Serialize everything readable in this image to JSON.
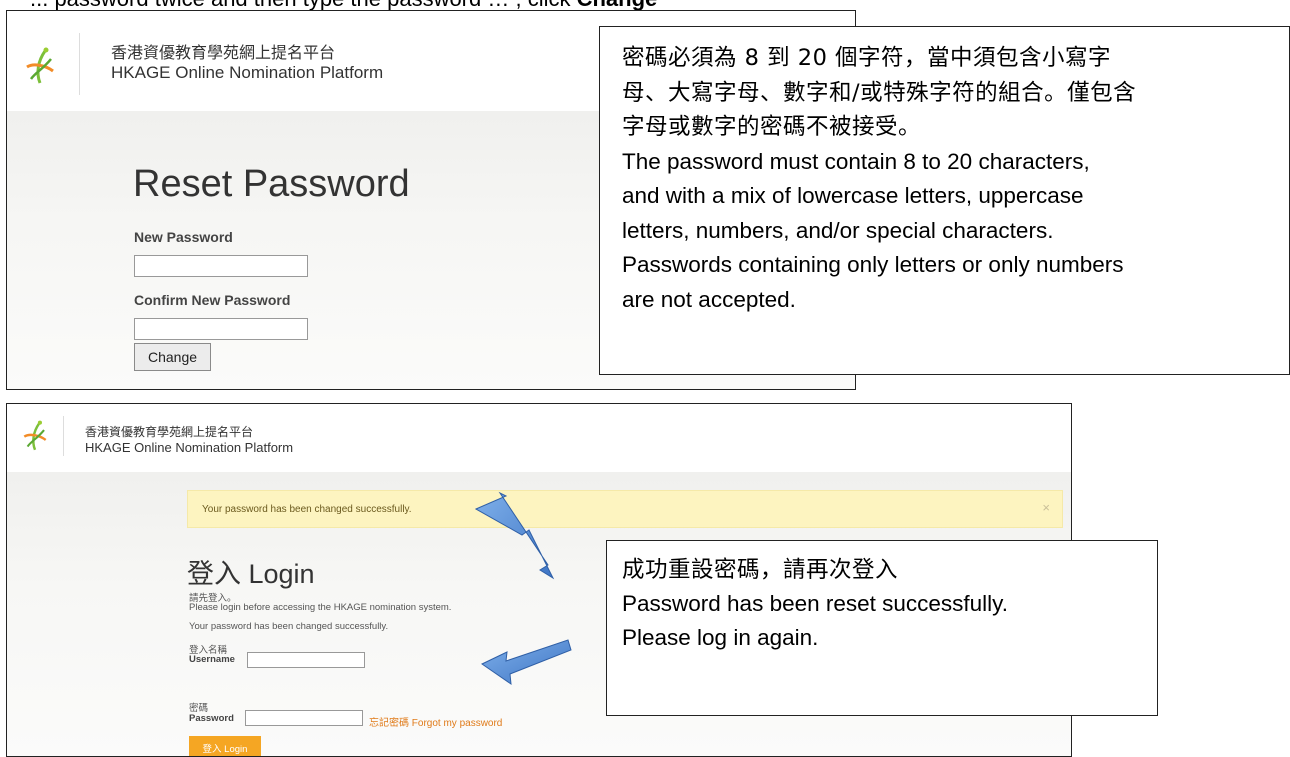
{
  "caption": {
    "text": "... password twice and then type the password …                                ; click ",
    "bold": "Change"
  },
  "screen1": {
    "brand_zh": "香港資優教育學苑網上提名平台",
    "brand_en": "HKAGE Online Nomination Platform",
    "heading": "Reset Password",
    "new_password_label": "New Password",
    "new_password_value": "",
    "confirm_label": "Confirm New Password",
    "confirm_value": "",
    "change_button": "Change"
  },
  "callout1": {
    "zh_line1": "密碼必須為 8 到 20 個字符，當中須包含小寫字",
    "zh_line2": "母、大寫字母、數字和/或特殊字符的組合。僅包含",
    "zh_line3": "字母或數字的密碼不被接受。",
    "en_line1": "The password must contain 8 to 20 characters,",
    "en_line2": "and with a mix of lowercase letters, uppercase",
    "en_line3": "letters, numbers, and/or special characters.",
    "en_line4": "Passwords containing only letters or only numbers",
    "en_line5": "are not accepted."
  },
  "screen2": {
    "brand_zh": "香港資優教育學苑網上提名平台",
    "brand_en": "HKAGE Online Nomination Platform",
    "alert_text": "Your password has been changed successfully.",
    "alert_close": "×",
    "heading": "登入 Login",
    "intro_zh": "請先登入。",
    "intro_en": "Please login before accessing the HKAGE nomination system.",
    "success_msg": "Your password has been changed successfully.",
    "username_zh": "登入名稱",
    "username_en": "Username",
    "username_value": "",
    "password_zh": "密碼",
    "password_en": "Password",
    "password_value": "",
    "forgot_link": "忘記密碼 Forgot my password",
    "login_button": "登入 Login"
  },
  "callout2": {
    "zh": "成功重設密碼，請再次登入",
    "en_line1": "Password has been reset successfully.",
    "en_line2": "Please log in again."
  },
  "colors": {
    "alert_bg": "#fdf4c0",
    "login_button": "#f5a623",
    "link": "#e07b1a",
    "arrow": "#4a86d6"
  },
  "icons": {
    "logo": "hkage-logo-icon",
    "arrow": "pointer-arrow-icon"
  }
}
